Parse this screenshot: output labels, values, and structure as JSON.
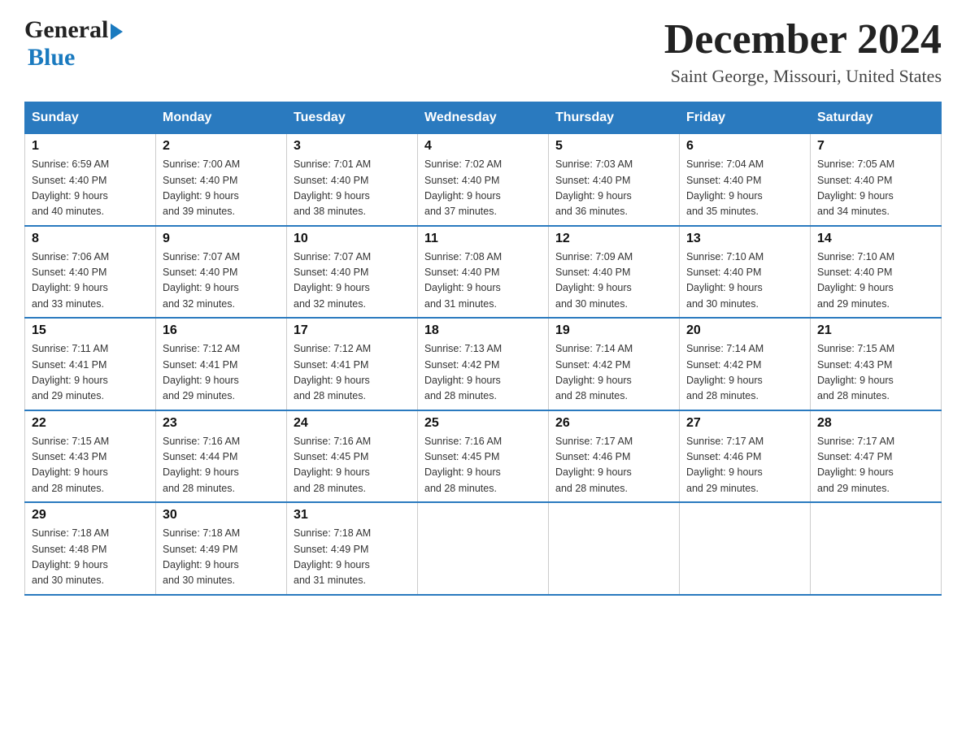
{
  "header": {
    "logo_general": "General",
    "logo_blue": "Blue",
    "month_title": "December 2024",
    "location": "Saint George, Missouri, United States"
  },
  "weekdays": [
    "Sunday",
    "Monday",
    "Tuesday",
    "Wednesday",
    "Thursday",
    "Friday",
    "Saturday"
  ],
  "weeks": [
    [
      {
        "day": "1",
        "sunrise": "6:59 AM",
        "sunset": "4:40 PM",
        "daylight": "9 hours and 40 minutes."
      },
      {
        "day": "2",
        "sunrise": "7:00 AM",
        "sunset": "4:40 PM",
        "daylight": "9 hours and 39 minutes."
      },
      {
        "day": "3",
        "sunrise": "7:01 AM",
        "sunset": "4:40 PM",
        "daylight": "9 hours and 38 minutes."
      },
      {
        "day": "4",
        "sunrise": "7:02 AM",
        "sunset": "4:40 PM",
        "daylight": "9 hours and 37 minutes."
      },
      {
        "day": "5",
        "sunrise": "7:03 AM",
        "sunset": "4:40 PM",
        "daylight": "9 hours and 36 minutes."
      },
      {
        "day": "6",
        "sunrise": "7:04 AM",
        "sunset": "4:40 PM",
        "daylight": "9 hours and 35 minutes."
      },
      {
        "day": "7",
        "sunrise": "7:05 AM",
        "sunset": "4:40 PM",
        "daylight": "9 hours and 34 minutes."
      }
    ],
    [
      {
        "day": "8",
        "sunrise": "7:06 AM",
        "sunset": "4:40 PM",
        "daylight": "9 hours and 33 minutes."
      },
      {
        "day": "9",
        "sunrise": "7:07 AM",
        "sunset": "4:40 PM",
        "daylight": "9 hours and 32 minutes."
      },
      {
        "day": "10",
        "sunrise": "7:07 AM",
        "sunset": "4:40 PM",
        "daylight": "9 hours and 32 minutes."
      },
      {
        "day": "11",
        "sunrise": "7:08 AM",
        "sunset": "4:40 PM",
        "daylight": "9 hours and 31 minutes."
      },
      {
        "day": "12",
        "sunrise": "7:09 AM",
        "sunset": "4:40 PM",
        "daylight": "9 hours and 30 minutes."
      },
      {
        "day": "13",
        "sunrise": "7:10 AM",
        "sunset": "4:40 PM",
        "daylight": "9 hours and 30 minutes."
      },
      {
        "day": "14",
        "sunrise": "7:10 AM",
        "sunset": "4:40 PM",
        "daylight": "9 hours and 29 minutes."
      }
    ],
    [
      {
        "day": "15",
        "sunrise": "7:11 AM",
        "sunset": "4:41 PM",
        "daylight": "9 hours and 29 minutes."
      },
      {
        "day": "16",
        "sunrise": "7:12 AM",
        "sunset": "4:41 PM",
        "daylight": "9 hours and 29 minutes."
      },
      {
        "day": "17",
        "sunrise": "7:12 AM",
        "sunset": "4:41 PM",
        "daylight": "9 hours and 28 minutes."
      },
      {
        "day": "18",
        "sunrise": "7:13 AM",
        "sunset": "4:42 PM",
        "daylight": "9 hours and 28 minutes."
      },
      {
        "day": "19",
        "sunrise": "7:14 AM",
        "sunset": "4:42 PM",
        "daylight": "9 hours and 28 minutes."
      },
      {
        "day": "20",
        "sunrise": "7:14 AM",
        "sunset": "4:42 PM",
        "daylight": "9 hours and 28 minutes."
      },
      {
        "day": "21",
        "sunrise": "7:15 AM",
        "sunset": "4:43 PM",
        "daylight": "9 hours and 28 minutes."
      }
    ],
    [
      {
        "day": "22",
        "sunrise": "7:15 AM",
        "sunset": "4:43 PM",
        "daylight": "9 hours and 28 minutes."
      },
      {
        "day": "23",
        "sunrise": "7:16 AM",
        "sunset": "4:44 PM",
        "daylight": "9 hours and 28 minutes."
      },
      {
        "day": "24",
        "sunrise": "7:16 AM",
        "sunset": "4:45 PM",
        "daylight": "9 hours and 28 minutes."
      },
      {
        "day": "25",
        "sunrise": "7:16 AM",
        "sunset": "4:45 PM",
        "daylight": "9 hours and 28 minutes."
      },
      {
        "day": "26",
        "sunrise": "7:17 AM",
        "sunset": "4:46 PM",
        "daylight": "9 hours and 28 minutes."
      },
      {
        "day": "27",
        "sunrise": "7:17 AM",
        "sunset": "4:46 PM",
        "daylight": "9 hours and 29 minutes."
      },
      {
        "day": "28",
        "sunrise": "7:17 AM",
        "sunset": "4:47 PM",
        "daylight": "9 hours and 29 minutes."
      }
    ],
    [
      {
        "day": "29",
        "sunrise": "7:18 AM",
        "sunset": "4:48 PM",
        "daylight": "9 hours and 30 minutes."
      },
      {
        "day": "30",
        "sunrise": "7:18 AM",
        "sunset": "4:49 PM",
        "daylight": "9 hours and 30 minutes."
      },
      {
        "day": "31",
        "sunrise": "7:18 AM",
        "sunset": "4:49 PM",
        "daylight": "9 hours and 31 minutes."
      },
      null,
      null,
      null,
      null
    ]
  ],
  "labels": {
    "sunrise": "Sunrise:",
    "sunset": "Sunset:",
    "daylight": "Daylight:"
  }
}
